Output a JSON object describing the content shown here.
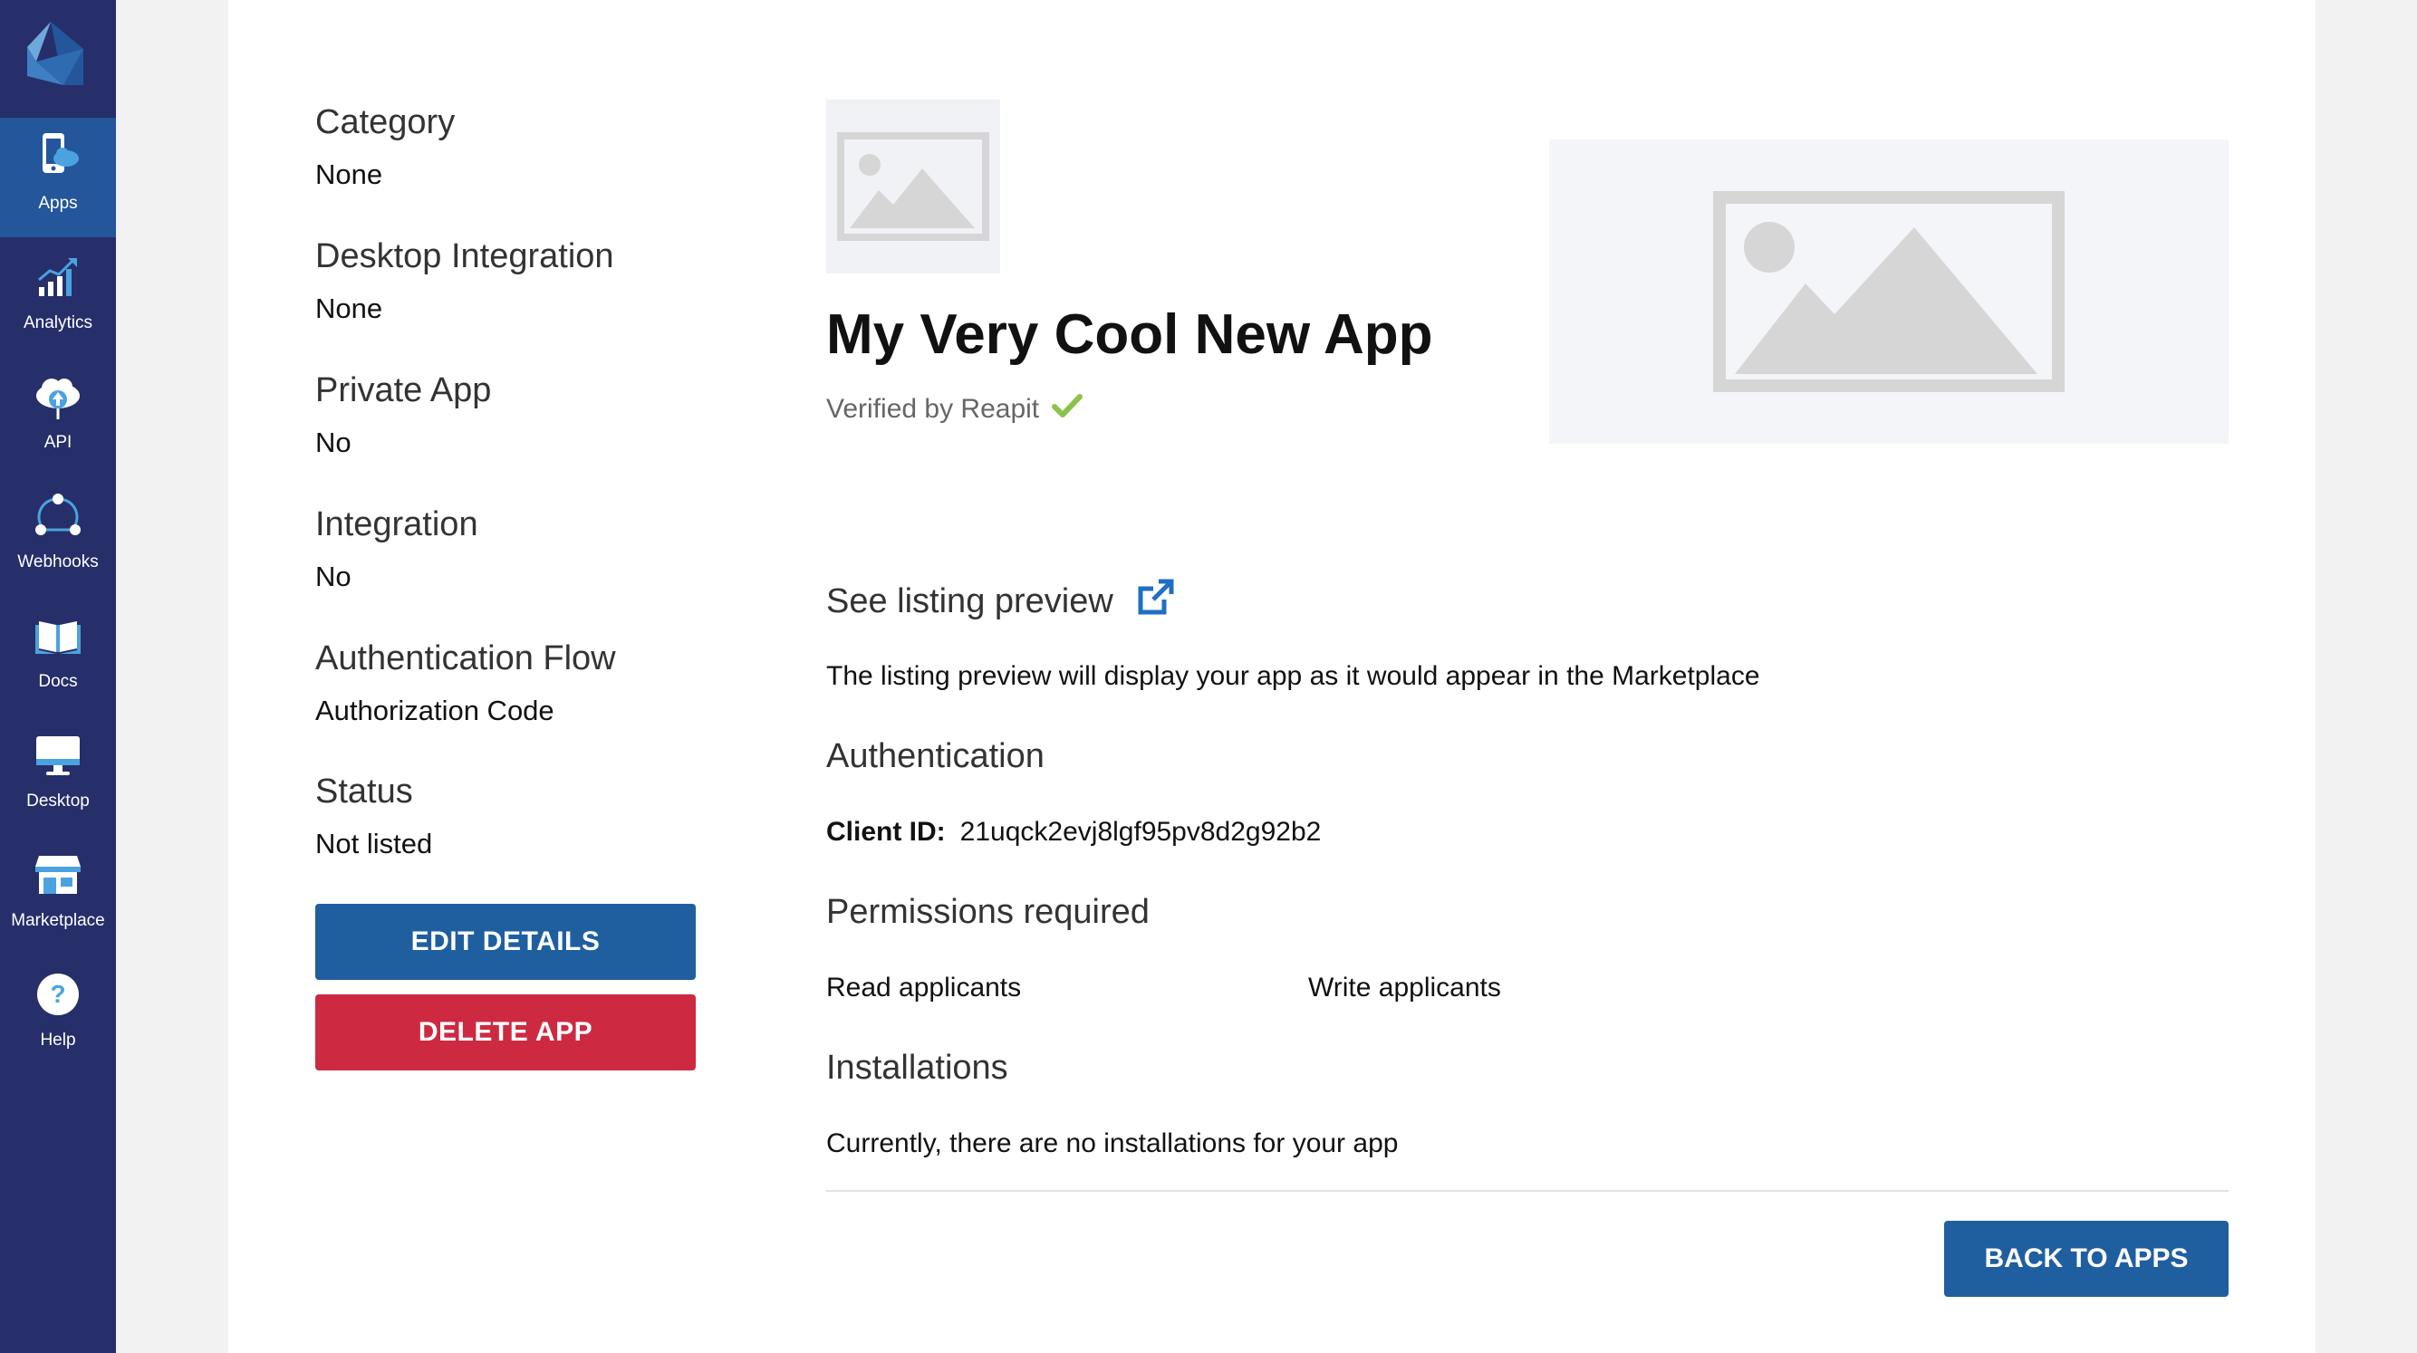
{
  "sidebar": {
    "items": [
      {
        "label": "Apps",
        "icon": "phone-cloud-icon",
        "active": true
      },
      {
        "label": "Analytics",
        "icon": "chart-growth-icon"
      },
      {
        "label": "API",
        "icon": "cloud-upload-icon"
      },
      {
        "label": "Webhooks",
        "icon": "webhooks-icon"
      },
      {
        "label": "Docs",
        "icon": "book-icon"
      },
      {
        "label": "Desktop",
        "icon": "monitor-icon"
      },
      {
        "label": "Marketplace",
        "icon": "storefront-icon"
      },
      {
        "label": "Help",
        "icon": "help-icon"
      }
    ]
  },
  "details": {
    "category": {
      "label": "Category",
      "value": "None"
    },
    "desktop_integration": {
      "label": "Desktop Integration",
      "value": "None"
    },
    "private_app": {
      "label": "Private App",
      "value": "No"
    },
    "integration": {
      "label": "Integration",
      "value": "No"
    },
    "auth_flow": {
      "label": "Authentication Flow",
      "value": "Authorization Code"
    },
    "status": {
      "label": "Status",
      "value": "Not listed"
    }
  },
  "actions": {
    "edit_label": "EDIT DETAILS",
    "delete_label": "DELETE APP",
    "back_label": "BACK TO APPS"
  },
  "app": {
    "name": "My Very Cool New App",
    "verified_text": "Verified by Reapit"
  },
  "listing_preview": {
    "heading": "See listing preview",
    "description": "The listing preview will display your app as it would appear in the Marketplace"
  },
  "authentication": {
    "heading": "Authentication",
    "client_id_label": "Client ID:",
    "client_id_value": "21uqck2evj8lgf95pv8d2g92b2"
  },
  "permissions": {
    "heading": "Permissions required",
    "items": [
      "Read applicants",
      "Write applicants"
    ]
  },
  "installations": {
    "heading": "Installations",
    "text": "Currently, there are no installations for your app"
  },
  "colors": {
    "sidebar_bg": "#262f69",
    "sidebar_active": "#23569b",
    "primary": "#1f5fa0",
    "danger": "#cd2a42",
    "verified_check": "#8bc34a"
  }
}
